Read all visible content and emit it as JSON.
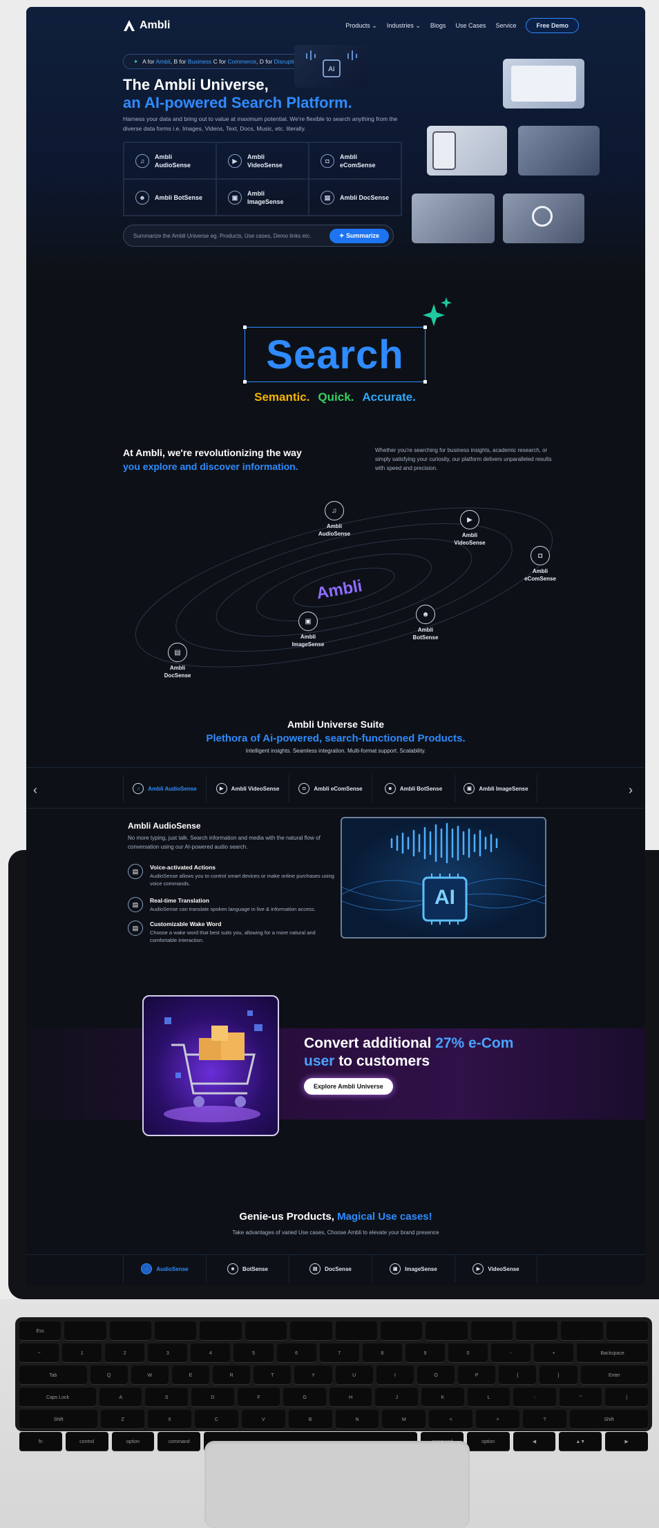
{
  "nav": {
    "logo": "Ambli",
    "links": [
      "Products",
      "Industries",
      "Blogs",
      "Use Cases",
      "Service"
    ],
    "cta": "Free Demo"
  },
  "hero": {
    "tagline": {
      "p1": "A for ",
      "w1": "Ambli",
      "p2": ", B for ",
      "w2": "Business",
      "p3": " C for ",
      "w3": "Commerce",
      "p4": ", D for ",
      "w4": "Disruption",
      "p5": "."
    },
    "title_line1": "The Ambli Universe,",
    "title_line2": "an AI-powered Search Platform.",
    "description": "Harness your data and bring out to value at maximum potential. We're flexible to search anything from the diverse data forms i.e. Images, Videos, Text, Docs, Music, etc. literally.",
    "products": [
      {
        "line1": "Ambli",
        "line2": "AudioSense"
      },
      {
        "line1": "Ambli",
        "line2": "VideoSense"
      },
      {
        "line1": "Ambli",
        "line2": "eComSense"
      },
      {
        "line1": "Ambli BotSense",
        "line2": ""
      },
      {
        "line1": "Ambli",
        "line2": "ImageSense"
      },
      {
        "line1": "Ambli DocSense",
        "line2": ""
      }
    ],
    "summarize_placeholder": "Summarize the Ambli Universe eg. Products, Use cases, Demo links etc.",
    "summarize_button": "Summarize"
  },
  "search": {
    "word": "Search",
    "sub1": "Semantic.",
    "sub2": "Quick.",
    "sub3": "Accurate.",
    "colors": {
      "sub1": "#f5b400",
      "sub2": "#3ad15e",
      "sub3": "#2fa8ff"
    }
  },
  "revolution": {
    "title_line1": "At Ambli, we're revolutionizing the way",
    "title_line2": "you explore and discover information.",
    "description": "Whether you're searching for business insights, academic research, or simply satisfying your curiosity, our platform delivers unparalleled results with speed and precision."
  },
  "orbit": {
    "center": "Ambli",
    "nodes": [
      {
        "line1": "Ambli",
        "line2": "AudioSense"
      },
      {
        "line1": "Ambli",
        "line2": "VideoSense"
      },
      {
        "line1": "Ambli",
        "line2": "eComSense"
      },
      {
        "line1": "Ambli",
        "line2": "ImageSense"
      },
      {
        "line1": "Ambli",
        "line2": "BotSense"
      },
      {
        "line1": "Ambli",
        "line2": "DocSense"
      }
    ]
  },
  "suite": {
    "title": "Ambli Universe Suite",
    "subtitle": "Plethora of Ai-powered, search-functioned Products.",
    "description": "Intelligent insights. Seamless integration. Multi-format support. Scalability.",
    "tabs": [
      "Ambli AudioSense",
      "Ambli VideoSense",
      "Ambli eComSense",
      "Ambli BotSense",
      "Ambli ImageSense"
    ]
  },
  "audiosense": {
    "title": "Ambli AudioSense",
    "description": "No more typing, just talk. Search information and media with the natural flow of conversation using our AI-powered audio search.",
    "features": [
      {
        "title": "Voice-activated Actions",
        "desc": "AudioSense allows you to control smart devices or make online purchases using voice commands."
      },
      {
        "title": "Real-time Translation",
        "desc": "AudioSense can translate spoken language in live & information access."
      },
      {
        "title": "Customizable Wake Word",
        "desc": "Choose a wake word that best suits you, allowing for a more natural and comfortable interaction."
      }
    ],
    "chip_label": "AI"
  },
  "promo": {
    "title_part1": "Convert additional ",
    "title_highlight1": "27% e-Com",
    "title_highlight2": "user",
    "title_part2": " to customers",
    "button": "Explore Ambli Universe"
  },
  "genie": {
    "title_part1": "Genie-us Products, ",
    "title_highlight": "Magical Use cases!",
    "description": "Take advantages of varied Use cases, Choose Ambli to elevate your brand presence",
    "tabs": [
      "AudioSense",
      "BotSense",
      "DocSense",
      "ImageSense",
      "VideoSense"
    ]
  },
  "keyboard": {
    "row1": [
      "Esc",
      "",
      "",
      "",
      "",
      "",
      "",
      "",
      "",
      "",
      "",
      "",
      "",
      ""
    ],
    "row2": [
      "~",
      "1",
      "2",
      "3",
      "4",
      "5",
      "6",
      "7",
      "8",
      "9",
      "0",
      "-",
      "+",
      "Backspace"
    ],
    "row3": [
      "Tab",
      "Q",
      "W",
      "E",
      "R",
      "T",
      "Y",
      "U",
      "I",
      "O",
      "P",
      "{",
      "}",
      "Enter"
    ],
    "row4": [
      "Caps Lock",
      "A",
      "S",
      "D",
      "F",
      "G",
      "H",
      "J",
      "K",
      "L",
      ":",
      "\"",
      "|"
    ],
    "row5": [
      "Shift",
      "Z",
      "X",
      "C",
      "V",
      "B",
      "N",
      "M",
      "<",
      ">",
      "?",
      "Shift"
    ],
    "row6": [
      "fn",
      "control",
      "option",
      "command",
      "",
      "command",
      "option",
      "◀",
      "▲▼",
      "▶"
    ]
  }
}
